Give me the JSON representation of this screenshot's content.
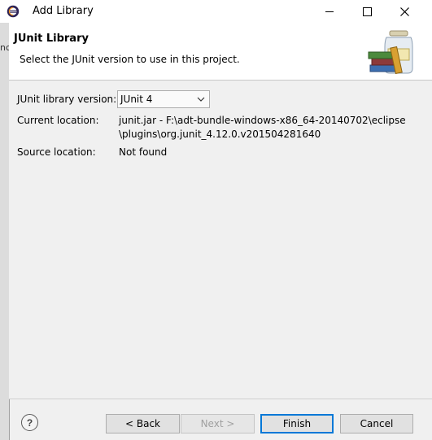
{
  "window": {
    "title": "Add Library",
    "app_icon": "eclipse-icon",
    "controls": [
      "minimize-icon",
      "maximize-icon",
      "close-icon"
    ]
  },
  "background": {
    "text": "nc"
  },
  "banner": {
    "title": "JUnit Library",
    "description": "Select the JUnit version to use in this project.",
    "graphic": "library-jar-books-icon"
  },
  "form": {
    "version_label": "JUnit library version:",
    "version_value": "JUnit 4",
    "current_location_label": "Current location:",
    "current_location_line1": "junit.jar - F:\\adt-bundle-windows-x86_64-20140702\\eclipse",
    "current_location_line2": "\\plugins\\org.junit_4.12.0.v201504281640",
    "source_location_label": "Source location:",
    "source_location_value": "Not found"
  },
  "buttons": {
    "help": "?",
    "back": "< Back",
    "next": "Next >",
    "finish": "Finish",
    "cancel": "Cancel"
  },
  "colors": {
    "accent": "#0078d7",
    "disabled_text": "#a0a0a0"
  }
}
